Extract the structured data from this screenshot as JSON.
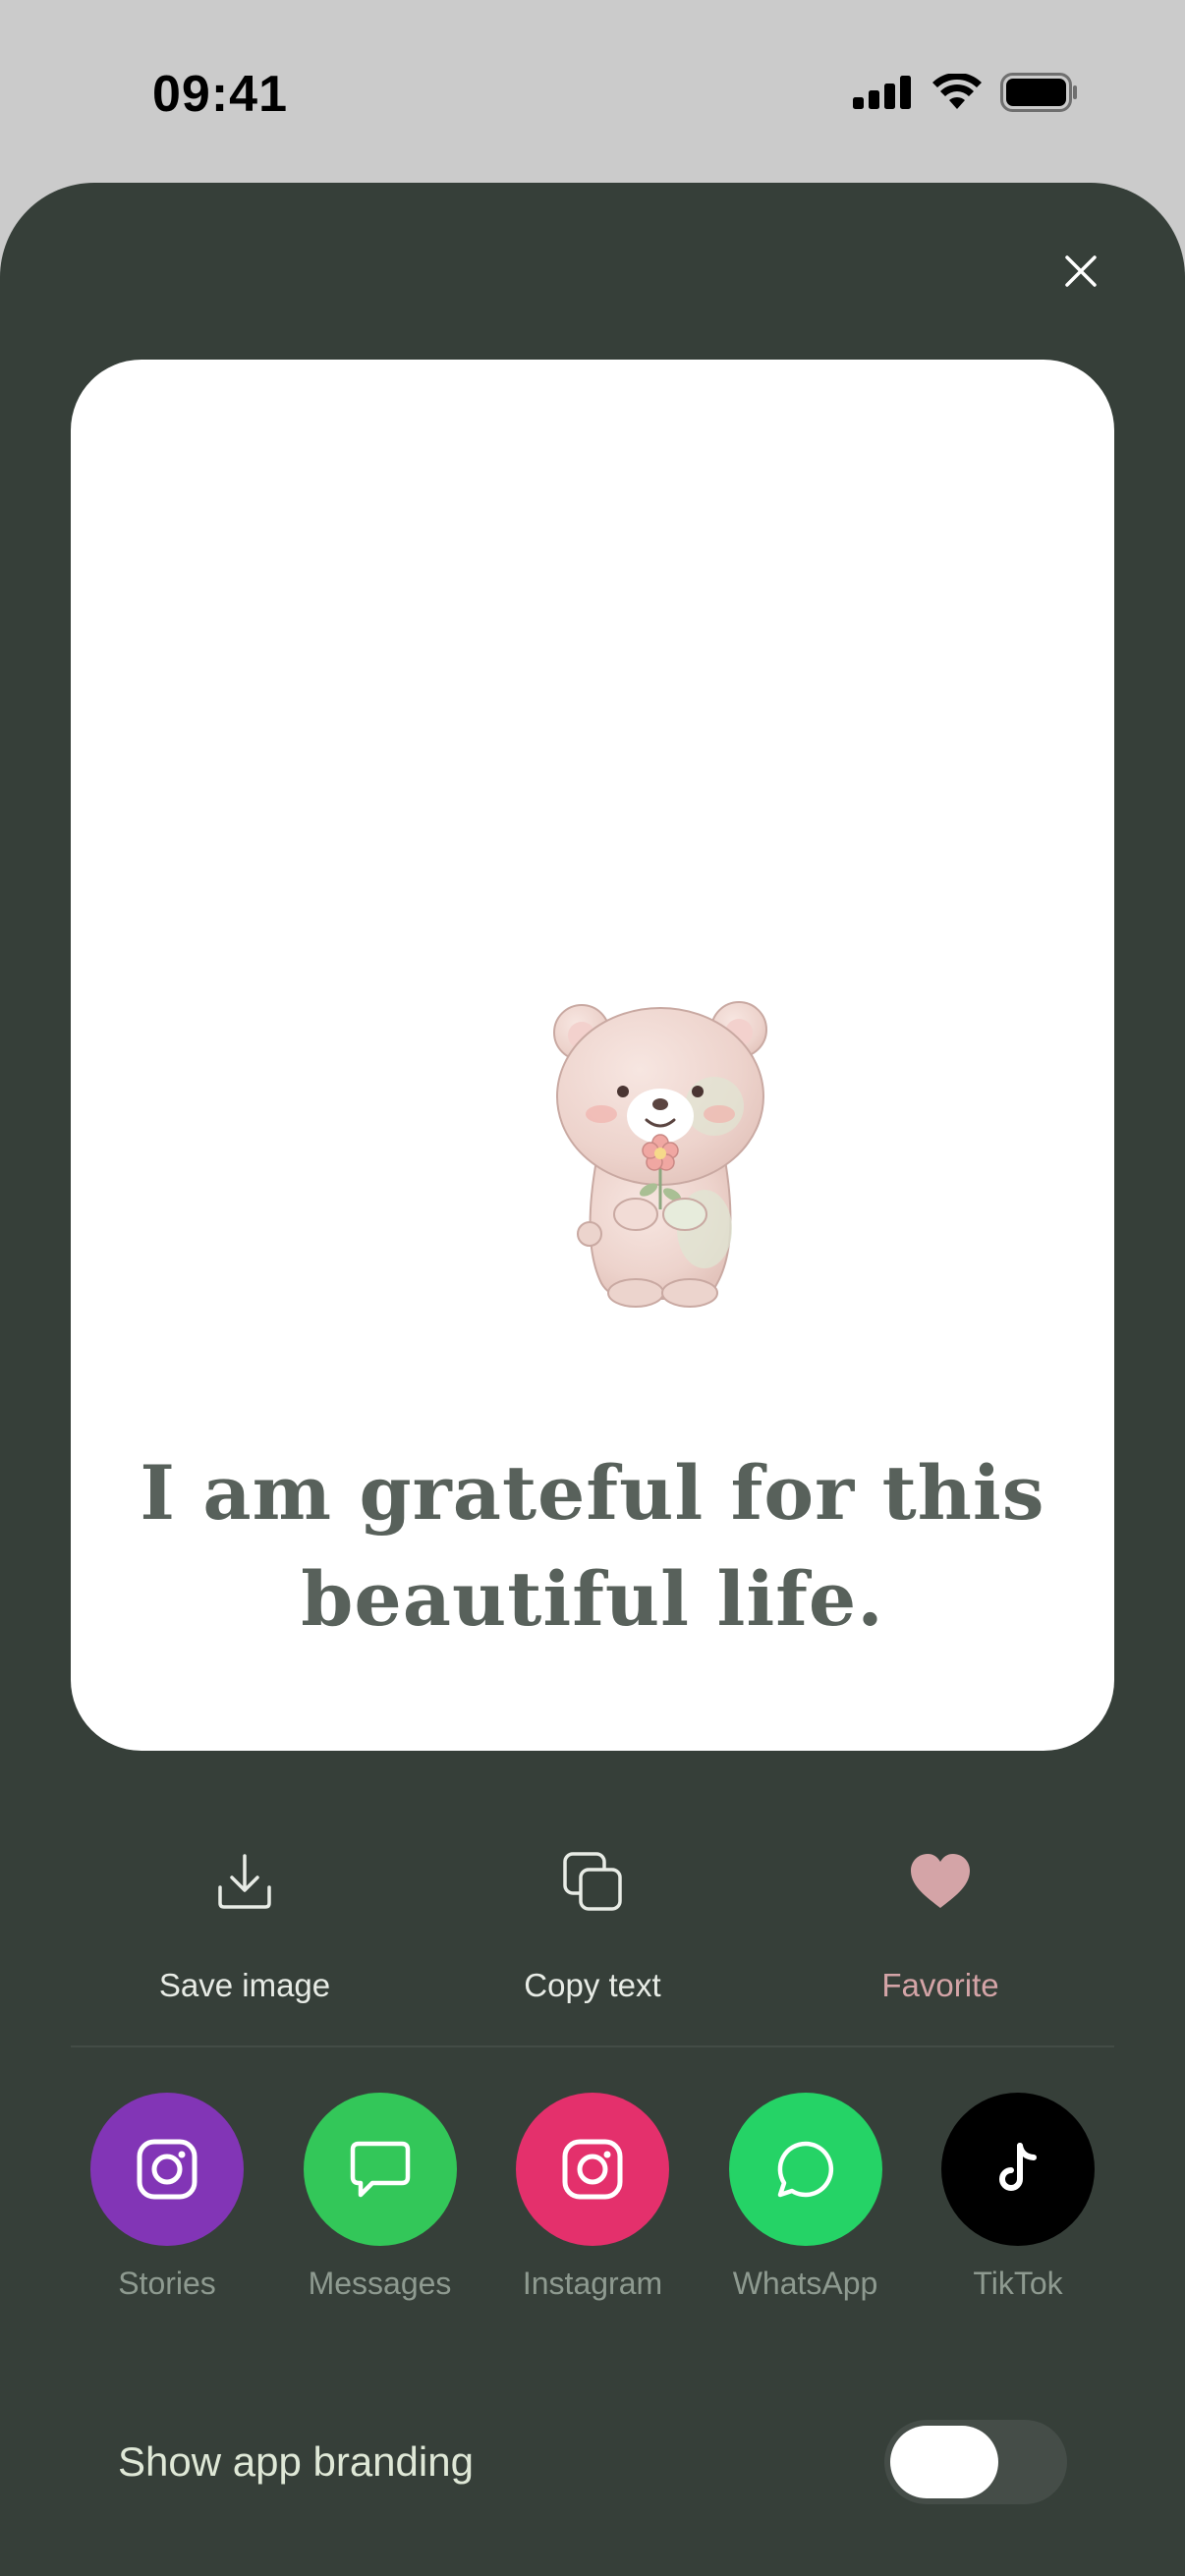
{
  "status_bar": {
    "time": "09:41"
  },
  "card": {
    "quote_line_1": "I am grateful for this",
    "quote_line_2": "beautiful life."
  },
  "actions": {
    "save_label": "Save image",
    "copy_label": "Copy text",
    "favorite_label": "Favorite"
  },
  "share": [
    {
      "label": "Stories",
      "color": "#8235b6",
      "icon": "instagram-icon"
    },
    {
      "label": "Messages",
      "color": "#33c759",
      "icon": "message-bubble-icon"
    },
    {
      "label": "Instagram",
      "color": "#e4306c",
      "icon": "instagram-icon"
    },
    {
      "label": "WhatsApp",
      "color": "#25d366",
      "icon": "whatsapp-icon"
    },
    {
      "label": "TikTok",
      "color": "#000000",
      "icon": "tiktok-icon"
    }
  ],
  "branding": {
    "label": "Show app branding",
    "toggle_on": false
  },
  "colors": {
    "sheet": "#363f39",
    "favorite": "#d4a4a7",
    "quote_text": "#58615b"
  }
}
